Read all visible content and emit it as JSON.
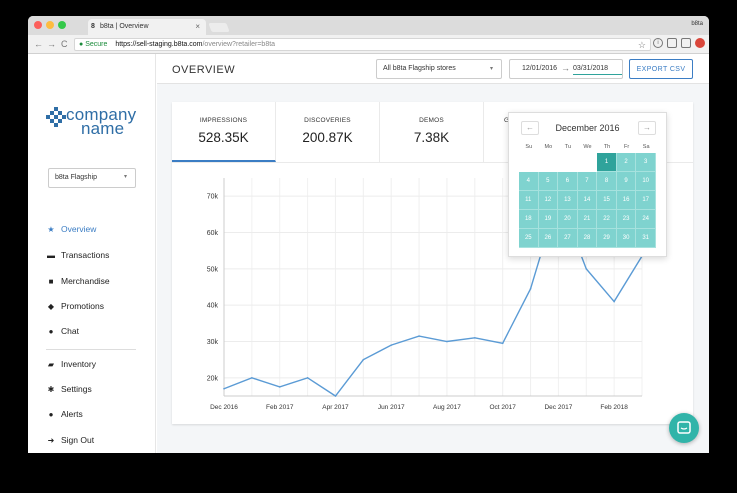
{
  "browser": {
    "tab_title": "b8ta | Overview",
    "tab_favicon": "8",
    "tab_close": "×",
    "profile_name": "b8ta",
    "secure_label": "Secure",
    "url_host": "https://sell-staging.b8ta.com",
    "url_path": "/overview?retailer=b8ta",
    "back": "←",
    "forward": "→",
    "reload": "C",
    "star": "☆"
  },
  "logo": {
    "line1": "company",
    "line2": "name"
  },
  "sidebar": {
    "retailer_select": "b8ta Flagship",
    "items": [
      {
        "label": "Overview",
        "icon": "star-icon"
      },
      {
        "label": "Transactions",
        "icon": "card-icon"
      },
      {
        "label": "Merchandise",
        "icon": "bag-icon"
      },
      {
        "label": "Promotions",
        "icon": "tag-icon"
      },
      {
        "label": "Chat",
        "icon": "chat-icon"
      },
      {
        "label": "Inventory",
        "icon": "truck-icon"
      },
      {
        "label": "Settings",
        "icon": "gear-icon"
      },
      {
        "label": "Alerts",
        "icon": "alert-icon"
      },
      {
        "label": "Sign Out",
        "icon": "signout-icon"
      }
    ]
  },
  "header": {
    "title": "OVERVIEW",
    "store_select": "All b8ta Flagship stores",
    "date_from": "12/01/2016",
    "date_to": "03/31/2018",
    "export_label": "EXPORT CSV"
  },
  "stats": [
    {
      "label": "IMPRESSIONS",
      "value": "528.35K"
    },
    {
      "label": "DISCOVERIES",
      "value": "200.87K"
    },
    {
      "label": "DEMOS",
      "value": "7.38K"
    },
    {
      "label": "G",
      "value": ""
    }
  ],
  "datepicker": {
    "month": "December 2016",
    "prev": "←",
    "next": "→",
    "weekdays": [
      "Su",
      "Mo",
      "Tu",
      "We",
      "Th",
      "Fr",
      "Sa"
    ],
    "weeks": [
      [
        "",
        "",
        "",
        "",
        "1",
        "2",
        "3"
      ],
      [
        "4",
        "5",
        "6",
        "7",
        "8",
        "9",
        "10"
      ],
      [
        "11",
        "12",
        "13",
        "14",
        "15",
        "16",
        "17"
      ],
      [
        "18",
        "19",
        "20",
        "21",
        "22",
        "23",
        "24"
      ],
      [
        "25",
        "26",
        "27",
        "28",
        "29",
        "30",
        "31"
      ]
    ],
    "selected_start": "1"
  },
  "colors": {
    "accent": "#3b7dc4",
    "teal": "#2fa39b",
    "teal_light": "#7fd3cf",
    "line": "#5b9bd5"
  },
  "chart_data": {
    "type": "line",
    "x": [
      "Dec 2016",
      "Jan 2017",
      "Feb 2017",
      "Mar 2017",
      "Apr 2017",
      "May 2017",
      "Jun 2017",
      "Jul 2017",
      "Aug 2017",
      "Sep 2017",
      "Oct 2017",
      "Nov 2017",
      "Dec 2017",
      "Jan 2018",
      "Feb 2018",
      "Mar 2018"
    ],
    "x_tick_labels": [
      "Dec 2016",
      "Feb 2017",
      "Apr 2017",
      "Jun 2017",
      "Aug 2017",
      "Oct 2017",
      "Dec 2017",
      "Feb 2018"
    ],
    "series": [
      {
        "values": [
          17000,
          20000,
          17500,
          20000,
          15000,
          25000,
          29000,
          31500,
          30000,
          31000,
          29500,
          44500,
          70000,
          50000,
          41000,
          53500
        ]
      }
    ],
    "y_ticks": [
      20000,
      30000,
      40000,
      50000,
      60000,
      70000
    ],
    "y_tick_labels": [
      "20k",
      "30k",
      "40k",
      "50k",
      "60k",
      "70k"
    ],
    "ylim": [
      15000,
      75000
    ],
    "grid": true
  }
}
